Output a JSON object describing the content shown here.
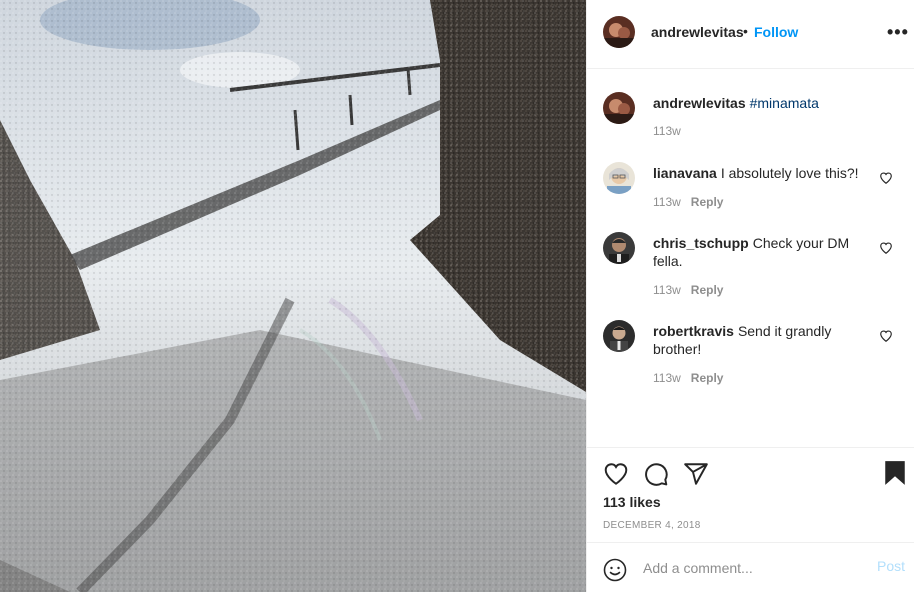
{
  "post": {
    "author": "andrewlevitas",
    "separator": "•",
    "follow_label": "Follow",
    "more_icon": "more-horizontal-icon",
    "more_label": "•••"
  },
  "caption": {
    "username": "andrewlevitas",
    "hashtag": "#minamata",
    "time": "113w"
  },
  "comments": [
    {
      "username": "lianavana",
      "text": "I absolutely love this?!",
      "time": "113w",
      "reply_label": "Reply"
    },
    {
      "username": "chris_tschupp",
      "text": "Check your DM fella.",
      "time": "113w",
      "reply_label": "Reply"
    },
    {
      "username": "robertkravis",
      "text": "Send it grandly brother!",
      "time": "113w",
      "reply_label": "Reply"
    }
  ],
  "actions": {
    "like_icon": "heart-icon",
    "comment_icon": "comment-bubble-icon",
    "share_icon": "paper-plane-icon",
    "save_icon": "bookmark-filled-icon",
    "likes": "113 likes",
    "date": "DECEMBER 4, 2018"
  },
  "comment_box": {
    "emoji_icon": "smiley-face-icon",
    "placeholder": "Add a comment...",
    "post_label": "Post"
  },
  "colors": {
    "accent": "#0095f6",
    "text": "#262626",
    "muted": "#8e8e8e",
    "post_disabled": "#b2dffc",
    "border": "#efefef"
  }
}
